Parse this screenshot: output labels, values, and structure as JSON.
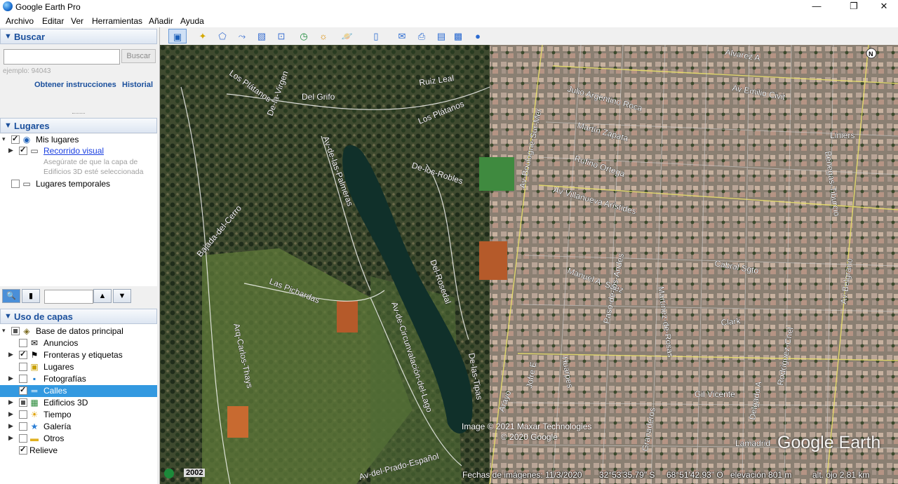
{
  "window": {
    "title": "Google Earth Pro",
    "minimize": "—",
    "maximize": "❐",
    "close": "✕"
  },
  "menu": [
    "Archivo",
    "Editar",
    "Ver",
    "Herramientas",
    "Añadir",
    "Ayuda"
  ],
  "search": {
    "header": "Buscar",
    "input_value": "",
    "button": "Buscar",
    "example": "ejemplo: 94043",
    "directions_link": "Obtener instrucciones",
    "history_link": "Historial"
  },
  "places": {
    "header": "Lugares",
    "items": [
      {
        "label": "Mis lugares",
        "checked": true
      },
      {
        "label": "Recorrido visual",
        "checked": true,
        "note": "Asegúrate de que la capa de Edificios 3D esté seleccionada"
      },
      {
        "label": "Lugares temporales",
        "checked": false
      }
    ]
  },
  "layers": {
    "header": "Uso de capas",
    "root": "Base de datos principal",
    "items": [
      {
        "label": "Anuncios",
        "checked": false,
        "icon": "envelope-icon"
      },
      {
        "label": "Fronteras y etiquetas",
        "checked": true,
        "icon": "flag-icon"
      },
      {
        "label": "Lugares",
        "checked": false,
        "icon": "places-icon"
      },
      {
        "label": "Fotografías",
        "checked": false,
        "icon": "photo-icon"
      },
      {
        "label": "Calles",
        "checked": true,
        "icon": "road-icon",
        "selected": true
      },
      {
        "label": "Edificios 3D",
        "checked": "partial",
        "icon": "building-icon"
      },
      {
        "label": "Tiempo",
        "checked": false,
        "icon": "sun-icon"
      },
      {
        "label": "Galería",
        "checked": false,
        "icon": "star-icon"
      },
      {
        "label": "Otros",
        "checked": false,
        "icon": "folder-icon"
      }
    ],
    "relief": {
      "label": "Relieve",
      "checked": true
    }
  },
  "map": {
    "roads": [
      "Los Plátanos",
      "Del Grifo",
      "Ruiz Leal",
      "Los Plátanos",
      "De-la-Virgen",
      "Av-de-las-Palmeras",
      "De-los-Robles",
      "Bajada-del-Cerro",
      "Las Pichardas",
      "Arq-Carlos-Thays",
      "Av-de-Circunvalación-del-Lago",
      "Del-Rosedal",
      "De-las-Tipas",
      "Av-del-Prado-Español",
      "Alvarez A",
      "Av Emilio Civit",
      "Julio Argentino Roca",
      "Martín Zapata",
      "Rufino Ortega",
      "Av Villanueva Arístides",
      "Liniers",
      "Av-Boulogne-Sur-Mer",
      "Benegas-Tiburcio",
      "Manuel A. Sáez",
      "Cabral Sgto",
      "Av-Belgrano",
      "Clark",
      "Gil Vicente",
      "Jofre E",
      "Huarpes",
      "Paso-de-los-Andes",
      "Martínez-de-Rosas",
      "Granaderos",
      "Rodríguez-Cnel",
      "Delgado A",
      "Lamadrid",
      "Arayo"
    ],
    "attribution": [
      "Image © 2021 Maxar Technologies",
      "© 2020 Google"
    ],
    "brand": "Google Earth",
    "year": "2002",
    "compass": "N"
  },
  "status": {
    "date": "Fechas de imágenes: 11/3/2020",
    "lat": "32°53'35.79\" S",
    "lon": "68°51'42.93\" O",
    "elevation": "elevación   801 m",
    "eye_alt": "alt. ojo   2.81 km"
  }
}
